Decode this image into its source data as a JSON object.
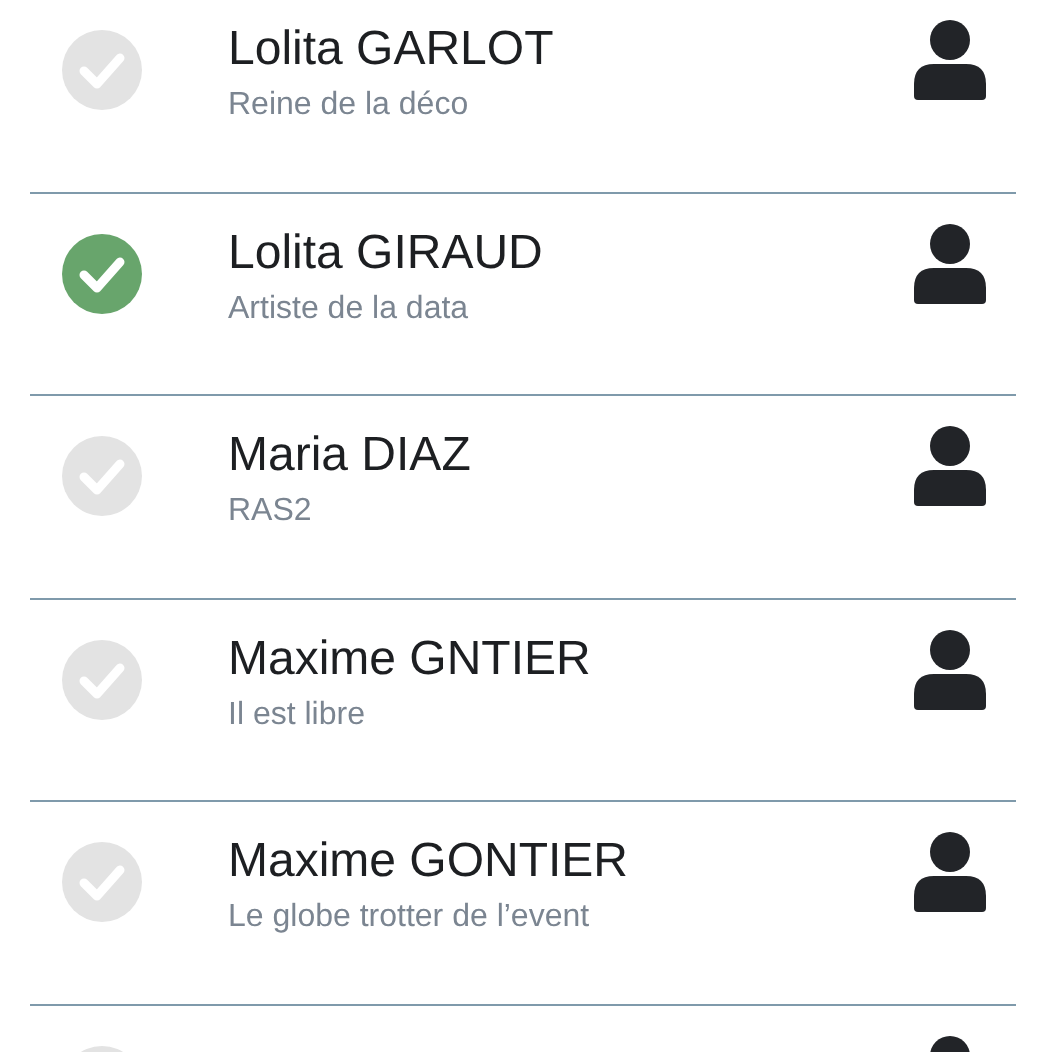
{
  "contacts": [
    {
      "name": "Lolita GARLOT",
      "subtitle": "Reine de la déco",
      "checked": false
    },
    {
      "name": "Lolita GIRAUD",
      "subtitle": "Artiste de la data",
      "checked": true
    },
    {
      "name": "Maria DIAZ",
      "subtitle": "RAS2",
      "checked": false
    },
    {
      "name": "Maxime GNTIER",
      "subtitle": "Il est libre",
      "checked": false
    },
    {
      "name": "Maxime GONTIER",
      "subtitle": "Le globe trotter de l’event",
      "checked": false
    },
    {
      "checked": false
    }
  ]
}
